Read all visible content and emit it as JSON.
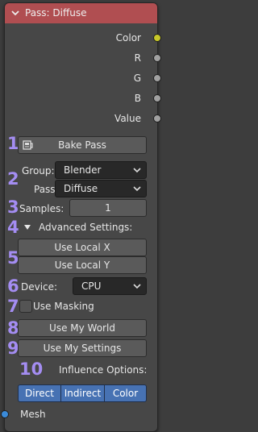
{
  "node": {
    "title": "Pass: Diffuse",
    "header_color": "#b04e51"
  },
  "outputs": [
    {
      "label": "Color",
      "socket_color": "yellow"
    },
    {
      "label": "R",
      "socket_color": "gray"
    },
    {
      "label": "G",
      "socket_color": "gray"
    },
    {
      "label": "B",
      "socket_color": "gray"
    },
    {
      "label": "Value",
      "socket_color": "gray"
    }
  ],
  "markers": [
    "1",
    "2",
    "3",
    "4",
    "5",
    "6",
    "7",
    "8",
    "9",
    "10"
  ],
  "bake": {
    "label": "Bake Pass",
    "icon": "bake-icon"
  },
  "group": {
    "label": "Group:",
    "value": "Blender"
  },
  "pass": {
    "label": "Pass:",
    "value": "Diffuse"
  },
  "samples": {
    "label": "Samples:",
    "value": "1"
  },
  "advanced": {
    "label": "Advanced Settings:"
  },
  "local_x": {
    "label": "Use Local X"
  },
  "local_y": {
    "label": "Use Local Y"
  },
  "device": {
    "label": "Device:",
    "value": "CPU"
  },
  "masking": {
    "label": "Use Masking",
    "checked": false
  },
  "world": {
    "label": "Use My World"
  },
  "settings": {
    "label": "Use My Settings"
  },
  "influence": {
    "label": "Influence Options:",
    "options": [
      "Direct",
      "Indirect",
      "Color"
    ]
  },
  "inputs": [
    {
      "label": "Mesh",
      "socket_color": "blue"
    }
  ],
  "colors": {
    "accent_purple": "#a48df2",
    "selected_blue": "#4772b3",
    "socket_yellow": "#c7c729",
    "socket_gray": "#a1a1a1",
    "socket_blue": "#3b8bd9"
  }
}
